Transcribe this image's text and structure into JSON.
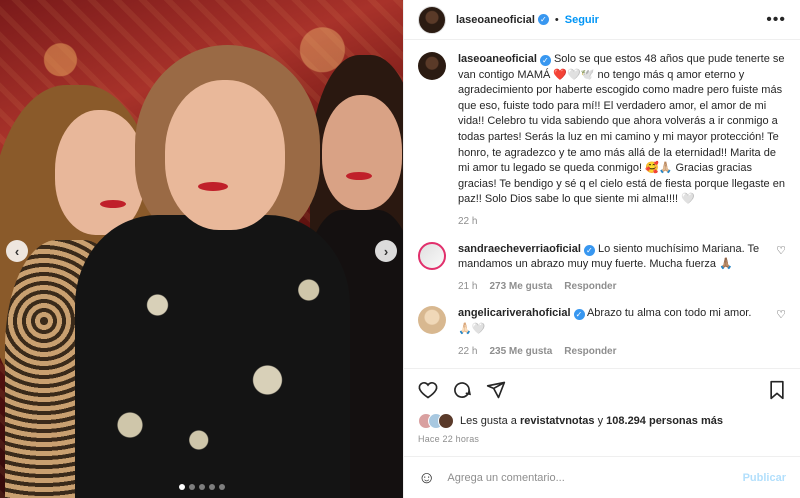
{
  "post": {
    "username": "laseoaneoficial",
    "follow_label": "Seguir",
    "more_icon": "more-horizontal-icon",
    "bullet": "•"
  },
  "caption": {
    "username": "laseoaneoficial",
    "text": "Solo se que estos 48 años que pude tenerte se van contigo MAMÁ ❤️🤍🕊️ no tengo más q amor eterno y agradecimiento por haberte escogido como madre pero fuiste más que eso, fuiste todo para mí!! El verdadero amor, el amor de mi vida!! Celebro tu vida sabiendo que ahora volverás a ir conmigo a todas partes! Serás la luz en mi camino y mi mayor protección! Te honro, te agradezco y te amo más allá de la eternidad!! Marita de mi amor tu legado se queda conmigo! 🥰🙏🏼 Gracias gracias gracias! Te bendigo y sé q el cielo está de fiesta porque llegaste en paz!! Solo Dios sabe lo que siente mi alma!!!! 🤍",
    "time": "22 h"
  },
  "comments": [
    {
      "username": "sandraecheverriaoficial",
      "text": "Lo siento muchísimo Mariana. Te mandamos un abrazo muy muy fuerte. Mucha fuerza 🙏🏽",
      "time": "21 h",
      "likes": "273 Me gusta",
      "reply": "Responder"
    },
    {
      "username": "angelicariverahoficial",
      "text": "Abrazo tu alma con todo mi amor. 🙏🏻🤍",
      "time": "22 h",
      "likes": "235 Me gusta",
      "reply": "Responder"
    }
  ],
  "actions": {
    "like_icon": "heart-icon",
    "comment_icon": "comment-icon",
    "share_icon": "share-icon",
    "save_icon": "bookmark-icon"
  },
  "likes": {
    "prefix": "Les gusta a",
    "user": "revistatvnotas",
    "middle": "y",
    "count": "108.294 personas más"
  },
  "posted": "Hace 22 horas",
  "add_comment": {
    "placeholder": "Agrega un comentario...",
    "publish_label": "Publicar"
  },
  "carousel": {
    "slides": 5,
    "active": 0
  }
}
